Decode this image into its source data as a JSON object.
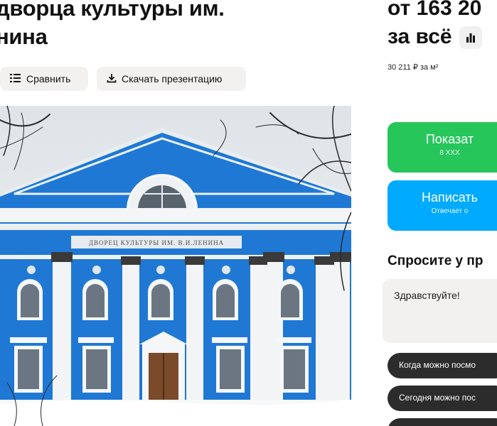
{
  "listing": {
    "title_line1": "дворца культуры им.",
    "title_line2": "нина"
  },
  "toolbar": {
    "compare_label": "Сравнить",
    "download_label": "Скачать презентацию"
  },
  "photo": {
    "facade_sign": "ДВОРЕЦ КУЛЬТУРЫ ИМ. В.И.ЛЕНИНА"
  },
  "price": {
    "line1": "от 163 20",
    "line2": "за всё",
    "per_m2": "30 211 ₽ за м²"
  },
  "actions": {
    "show_phone_label": "Показат",
    "show_phone_sub": "8 XXX",
    "write_label": "Написать",
    "write_sub": "Отвечает о"
  },
  "ask": {
    "heading": "Спросите у пр",
    "message_value": "Здравствуйте!",
    "chips": [
      "Когда можно посмо",
      "Сегодня можно пос",
      ""
    ]
  },
  "colors": {
    "green": "#26c65b",
    "blue": "#00aaff",
    "building_blue": "#1f78d4"
  }
}
